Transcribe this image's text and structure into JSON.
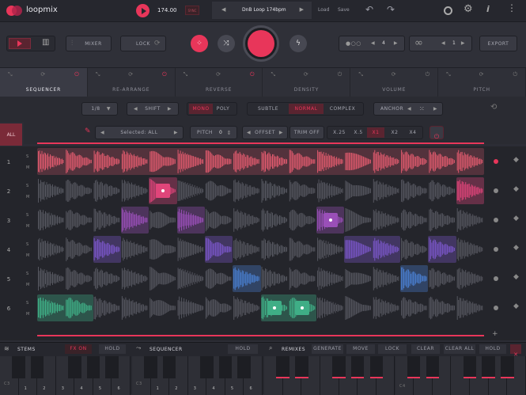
{
  "app": {
    "name": "loopmix",
    "bpm": "174.00",
    "sync": "SYNC",
    "loop_name": "DnB Loop 174bpm",
    "load": "Load",
    "save": "Save"
  },
  "controls": {
    "mixer": "MIXER",
    "lock": "LOCK",
    "count_a": "4",
    "count_b": "1",
    "export": "EXPORT"
  },
  "tabs": [
    {
      "label": "SEQUENCER"
    },
    {
      "label": "RE-ARRANGE"
    },
    {
      "label": "REVERSE"
    },
    {
      "label": "DENSITY"
    },
    {
      "label": "VOLUME"
    },
    {
      "label": "PITCH"
    }
  ],
  "options": {
    "division": "1/8",
    "shift": "SHIFT",
    "mono": "MONO",
    "poly": "POLY",
    "subtle": "SUBTLE",
    "normal": "NORMAL",
    "complex": "COMPLEX",
    "anchor": "ANCHOR"
  },
  "selection": {
    "selected": "Selected: ALL",
    "pitch_label": "PITCH",
    "pitch_value": "0",
    "offset": "OFFSET",
    "trim": "TRIM OFF",
    "x25": "X.25",
    "x5": "X.5",
    "x1": "X1",
    "x2": "X2",
    "x4": "X4"
  },
  "grid": {
    "all": "ALL",
    "rows": [
      "1",
      "2",
      "3",
      "4",
      "5",
      "6"
    ],
    "s": "S",
    "m": "M"
  },
  "bottom": {
    "stems": "STEMS",
    "fx_on": "FX ON",
    "hold": "HOLD",
    "sequencer": "SEQUENCER",
    "remixes": "REMIXES",
    "generate": "GENERATE",
    "move": "MOVE",
    "lock": "LOCK",
    "clear": "CLEAR",
    "clear_all": "CLEAR ALL",
    "c3": "C3",
    "c4": "C4",
    "keys": [
      "1",
      "2",
      "3",
      "4",
      "5",
      "6"
    ],
    "keys_b": [
      "1",
      "2",
      "3",
      "4",
      "5",
      "6"
    ]
  },
  "colors": {
    "accent": "#e8365a",
    "row1": "#e05a6e",
    "row2": "#e0457a",
    "row3": "#9a4fb8",
    "row4": "#7a56c8",
    "row5": "#4a7fd0",
    "row6": "#3fae86"
  }
}
